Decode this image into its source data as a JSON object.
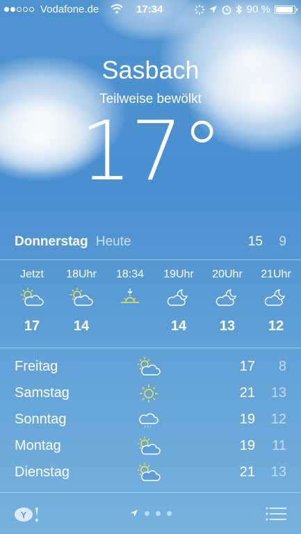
{
  "status": {
    "carrier": "Vodafone.de",
    "time": "17:34",
    "battery": "90 %"
  },
  "location": {
    "city": "Sasbach",
    "condition": "Teilweise bewölkt",
    "temperature": "17°"
  },
  "today": {
    "day": "Donnerstag",
    "label": "Heute",
    "high": "15",
    "low": "9"
  },
  "hourly": [
    {
      "time": "Jetzt",
      "icon": "partly-cloudy-day-icon",
      "temp": "17"
    },
    {
      "time": "18Uhr",
      "icon": "partly-cloudy-day-icon",
      "temp": "14"
    },
    {
      "time": "18:34",
      "icon": "sunset-icon",
      "temp": ""
    },
    {
      "time": "19Uhr",
      "icon": "partly-cloudy-night-icon",
      "temp": "14"
    },
    {
      "time": "20Uhr",
      "icon": "partly-cloudy-night-icon",
      "temp": "13"
    },
    {
      "time": "21Uhr",
      "icon": "partly-cloudy-night-icon",
      "temp": "12"
    }
  ],
  "daily": [
    {
      "day": "Freitag",
      "icon": "partly-cloudy-day-icon",
      "high": "17",
      "low": "8"
    },
    {
      "day": "Samstag",
      "icon": "sun-icon",
      "high": "21",
      "low": "13"
    },
    {
      "day": "Sonntag",
      "icon": "rain-cloud-icon",
      "high": "19",
      "low": "12"
    },
    {
      "day": "Montag",
      "icon": "partly-cloudy-day-icon",
      "high": "19",
      "low": "11"
    },
    {
      "day": "Dienstag",
      "icon": "partly-cloudy-day-icon",
      "high": "21",
      "low": "13"
    }
  ],
  "colors": {
    "sun": "#f2e24b",
    "background": "#4f93d1"
  }
}
